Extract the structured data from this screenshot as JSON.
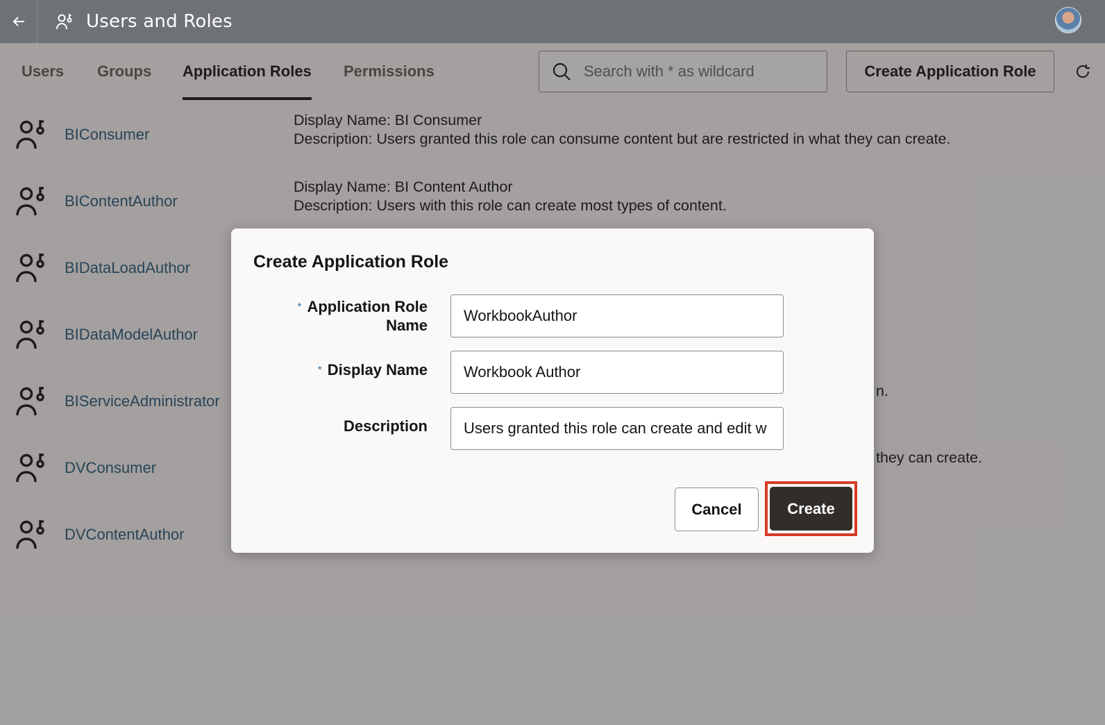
{
  "header": {
    "back_icon": "arrow-left-icon",
    "title_icon": "user-key-icon",
    "title": "Users and Roles",
    "avatar": "user-avatar"
  },
  "tabs": [
    {
      "label": "Users",
      "active": false
    },
    {
      "label": "Groups",
      "active": false
    },
    {
      "label": "Application Roles",
      "active": true
    },
    {
      "label": "Permissions",
      "active": false
    }
  ],
  "search": {
    "placeholder": "Search with * as wildcard",
    "value": "",
    "icon": "search-icon"
  },
  "toolbar": {
    "create_label": "Create Application Role",
    "refresh_icon": "refresh-icon"
  },
  "roles": [
    {
      "name": "BIConsumer",
      "display_line": "Display Name: BI Consumer",
      "desc_line": "Description: Users granted this role can consume content but are restricted in what they can create."
    },
    {
      "name": "BIContentAuthor",
      "display_line": "Display Name: BI Content Author",
      "desc_line": "Description: Users with this role can create most types of content."
    },
    {
      "name": "BIDataLoadAuthor",
      "display_line": "",
      "desc_line": ""
    },
    {
      "name": "BIDataModelAuthor",
      "display_line": "",
      "desc_line": ""
    },
    {
      "name": "BIServiceAdministrator",
      "display_line": "",
      "desc_line": "n."
    },
    {
      "name": "DVConsumer",
      "display_line": "",
      "desc_line": "they can create."
    },
    {
      "name": "DVContentAuthor",
      "display_line": "",
      "desc_line": ""
    }
  ],
  "dialog": {
    "title": "Create Application Role",
    "required_mark": "*",
    "fields": {
      "role_name": {
        "label_line1": "Application Role",
        "label_line2": "Name",
        "value": "WorkbookAuthor",
        "required": true
      },
      "display_name": {
        "label": "Display Name",
        "value": "Workbook Author",
        "required": true
      },
      "description": {
        "label": "Description",
        "value": "Users granted this role can create and edit w",
        "required": false
      }
    },
    "cancel_label": "Cancel",
    "create_label": "Create"
  }
}
